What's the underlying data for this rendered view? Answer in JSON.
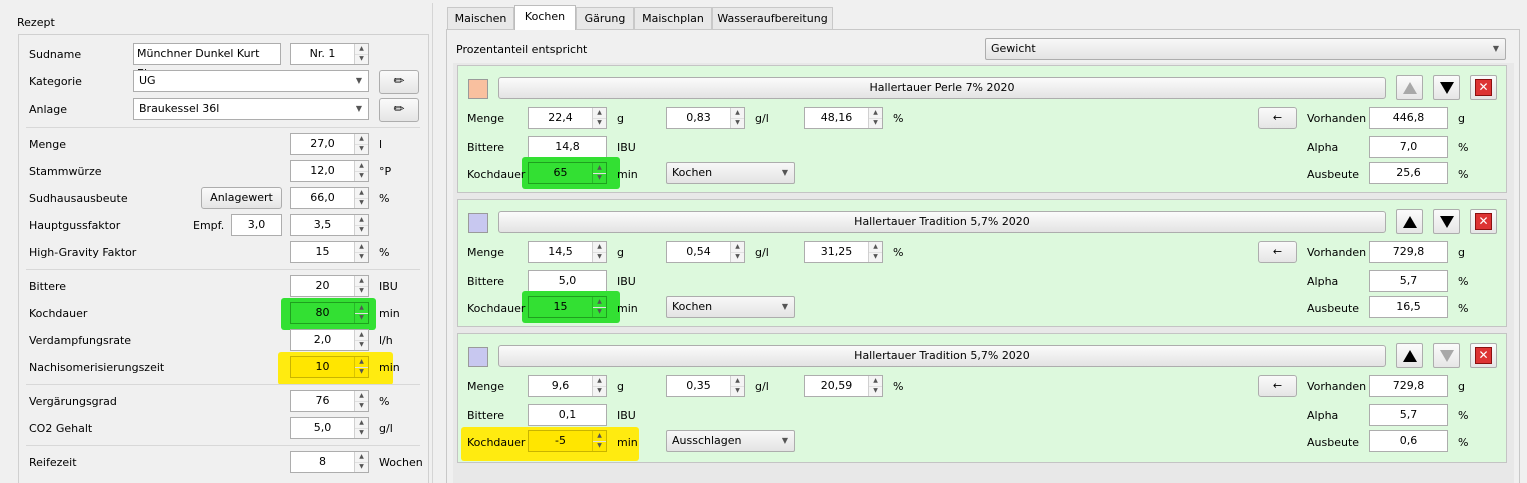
{
  "left": {
    "title": "Rezept",
    "sudname": {
      "label": "Sudname",
      "value": "Münchner Dunkel Kurt Eisner",
      "nr": "Nr. 1"
    },
    "kategorie": {
      "label": "Kategorie",
      "value": "UG"
    },
    "anlage": {
      "label": "Anlage",
      "value": "Braukessel 36l"
    },
    "menge": {
      "label": "Menge",
      "value": "27,0",
      "unit": "l"
    },
    "stammwuerze": {
      "label": "Stammwürze",
      "value": "12,0",
      "unit": "°P"
    },
    "sudhausausbeute": {
      "label": "Sudhausausbeute",
      "button": "Anlagewert",
      "value": "66,0",
      "unit": "%"
    },
    "hauptguss": {
      "label": "Hauptgussfaktor",
      "empf_label": "Empf.",
      "empf_value": "3,0",
      "value": "3,5"
    },
    "highgravity": {
      "label": "High-Gravity Faktor",
      "value": "15",
      "unit": "%"
    },
    "bittere": {
      "label": "Bittere",
      "value": "20",
      "unit": "IBU"
    },
    "kochdauer": {
      "label": "Kochdauer",
      "value": "80",
      "unit": "min"
    },
    "verdampfung": {
      "label": "Verdampfungsrate",
      "value": "2,0",
      "unit": "l/h"
    },
    "nachiso": {
      "label": "Nachisomerisierungszeit",
      "value": "10",
      "unit": "min"
    },
    "vergaerung": {
      "label": "Vergärungsgrad",
      "value": "76",
      "unit": "%"
    },
    "co2": {
      "label": "CO2 Gehalt",
      "value": "5,0",
      "unit": "g/l"
    },
    "reifezeit": {
      "label": "Reifezeit",
      "value": "8",
      "unit": "Wochen"
    }
  },
  "tabs": [
    "Maischen",
    "Kochen",
    "Gärung",
    "Maischplan",
    "Wasseraufbereitung"
  ],
  "active_tab": "Kochen",
  "prozent": {
    "label": "Prozentanteil entspricht",
    "value": "Gewicht"
  },
  "labels": {
    "menge": "Menge",
    "bittere": "Bittere",
    "kochdauer": "Kochdauer",
    "vorhanden": "Vorhanden",
    "alpha": "Alpha",
    "ausbeute": "Ausbeute",
    "g": "g",
    "gl": "g/l",
    "pct": "%",
    "ibu": "IBU",
    "min": "min",
    "arrow": "←"
  },
  "hops": [
    {
      "name": "Hallertauer Perle 7% 2020",
      "color": "#f9c09f",
      "menge": "22,4",
      "gl": "0,83",
      "pct": "48,16",
      "bittere": "14,8",
      "kochdauer": "65",
      "kochdauer_hl": "green",
      "phase": "Kochen",
      "vorhanden": "446,8",
      "alpha": "7,0",
      "ausbeute": "25,6",
      "up_enabled": false,
      "down_enabled": true
    },
    {
      "name": "Hallertauer Tradition 5,7% 2020",
      "color": "#c8c8f0",
      "menge": "14,5",
      "gl": "0,54",
      "pct": "31,25",
      "bittere": "5,0",
      "kochdauer": "15",
      "kochdauer_hl": "green",
      "phase": "Kochen",
      "vorhanden": "729,8",
      "alpha": "5,7",
      "ausbeute": "16,5",
      "up_enabled": true,
      "down_enabled": true
    },
    {
      "name": "Hallertauer Tradition 5,7% 2020",
      "color": "#c8c8f0",
      "menge": "9,6",
      "gl": "0,35",
      "pct": "20,59",
      "bittere": "0,1",
      "kochdauer": "-5",
      "kochdauer_hl": "yellow",
      "phase": "Ausschlagen",
      "vorhanden": "729,8",
      "alpha": "5,7",
      "ausbeute": "0,6",
      "up_enabled": true,
      "down_enabled": false
    }
  ]
}
